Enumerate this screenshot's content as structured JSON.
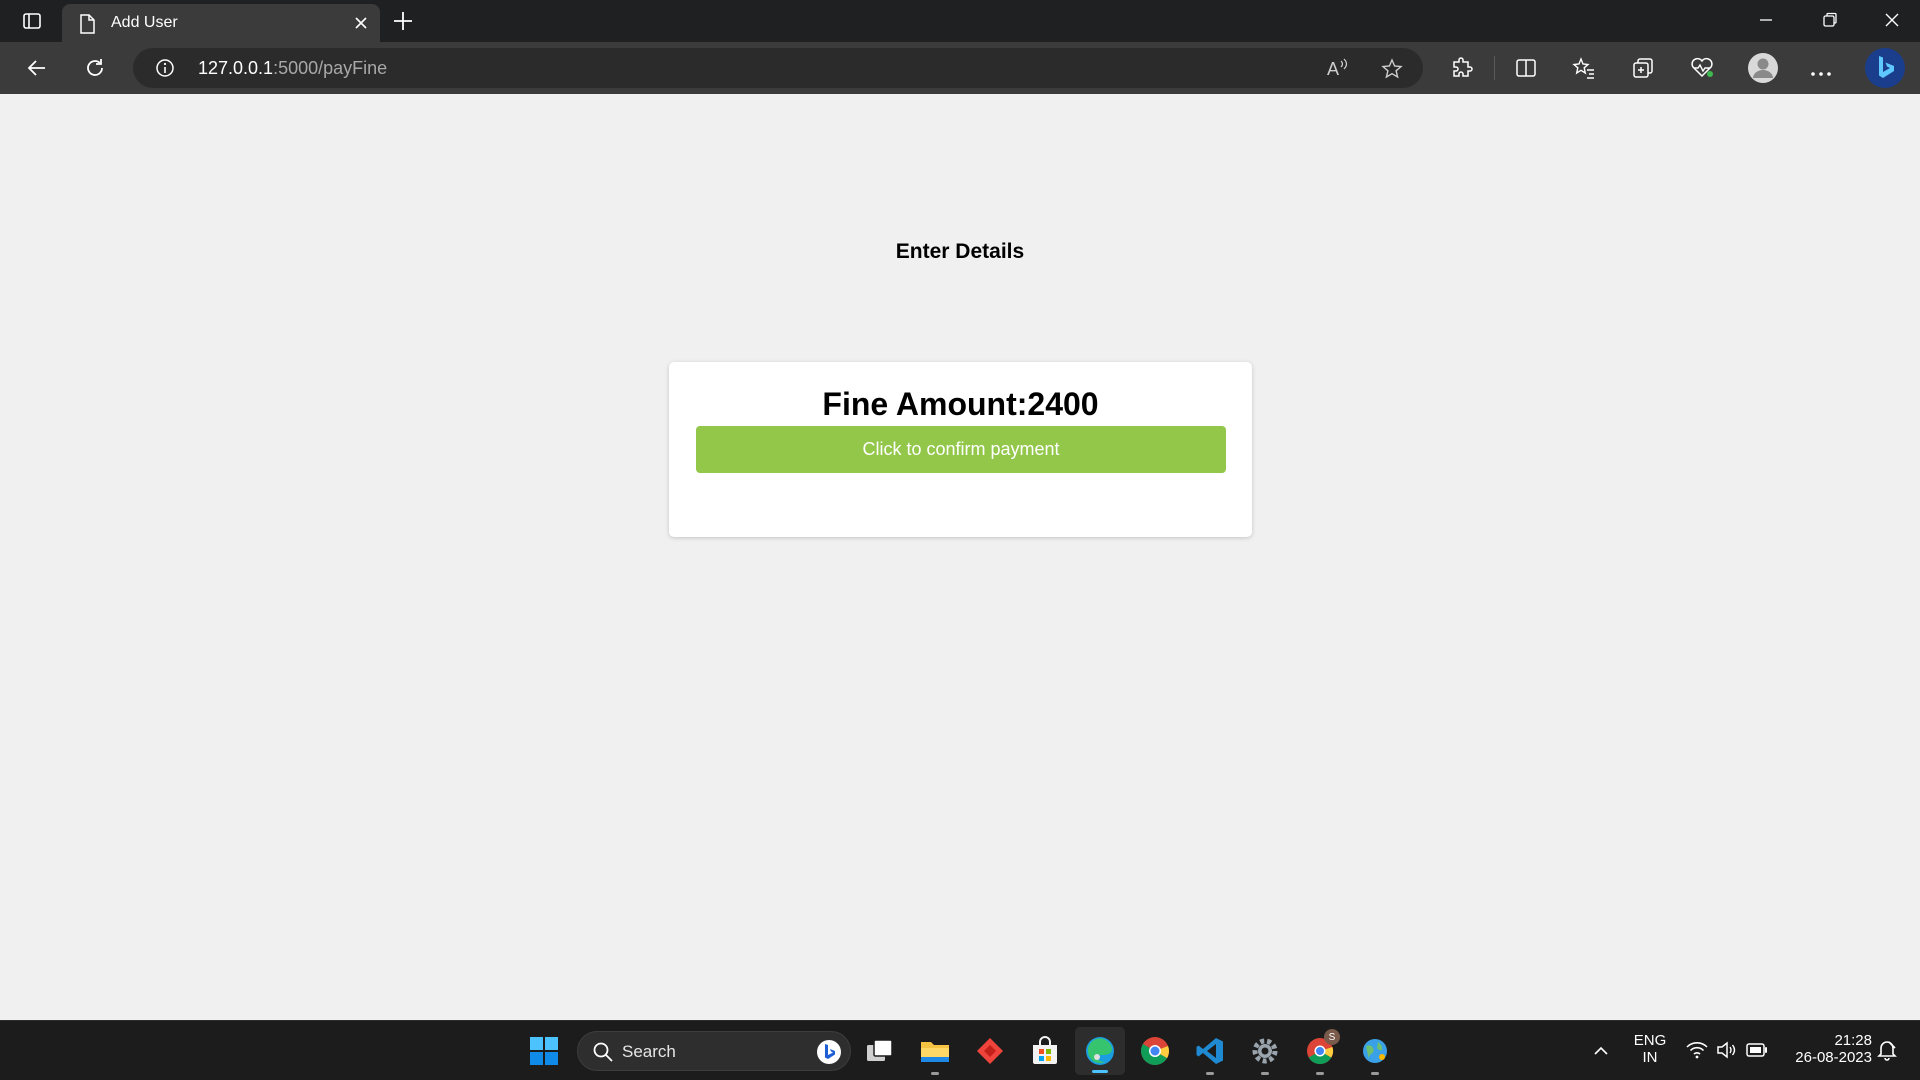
{
  "browser": {
    "tab_title": "Add User",
    "url_host": "127.0.0.1",
    "url_path": ":5000/payFine"
  },
  "page": {
    "heading": "Enter Details",
    "fine_label": "Fine Amount:",
    "fine_amount": "2400",
    "confirm_button": "Click to confirm payment",
    "accent_color": "#92c74a"
  },
  "taskbar": {
    "search_label": "Search",
    "language_line1": "ENG",
    "language_line2": "IN",
    "time": "21:28",
    "date": "26-08-2023",
    "chrome_badge": "S"
  }
}
